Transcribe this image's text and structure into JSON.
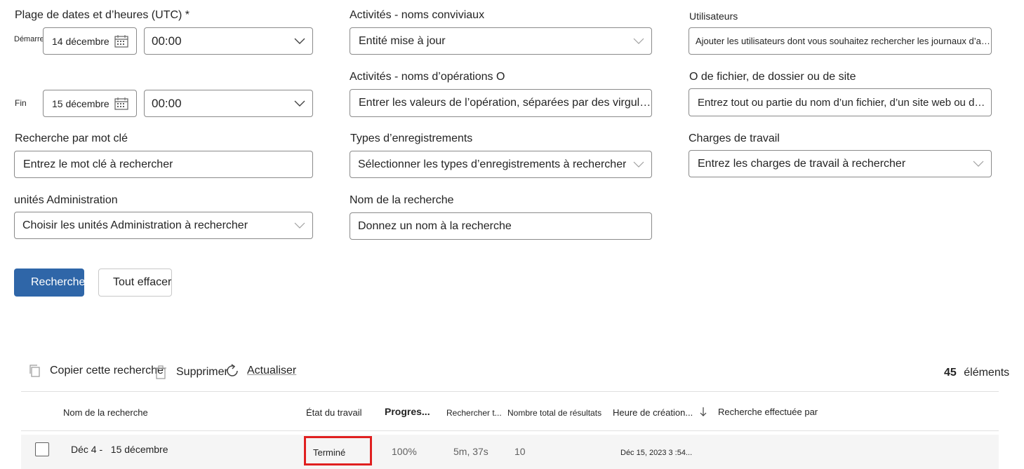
{
  "filters": {
    "date_range": {
      "label": "Plage de dates et d’heures (UTC) *",
      "start_label": "Démarrer",
      "start_date": "14 décembre",
      "start_time": "00:00",
      "end_label": "Fin",
      "end_date": "15 décembre",
      "end_time": "00:00"
    },
    "activities_friendly": {
      "label": "Activités - noms conviviaux",
      "value": "Entité mise à jour"
    },
    "activities_operations": {
      "label": "Activités - noms d’opérations O",
      "placeholder": "Entrer les valeurs de l’opération, séparées par des virgules"
    },
    "users": {
      "label": "Utilisateurs",
      "placeholder": "Ajouter les utilisateurs dont vous souhaitez rechercher les journaux d’audit"
    },
    "file_folder_site": {
      "label": "O de fichier, de dossier ou de site",
      "placeholder": "Entrez tout ou partie du nom d’un fichier, d’un site web ou d’un f…"
    },
    "keyword": {
      "label": "Recherche par mot clé",
      "placeholder": "Entrez le mot clé à rechercher"
    },
    "record_types": {
      "label": "Types d’enregistrements",
      "placeholder": "Sélectionner les types d’enregistrements à rechercher"
    },
    "workloads": {
      "label": "Charges de travail",
      "placeholder": "Entrez les charges de travail à rechercher"
    },
    "admin_units": {
      "label": "unités Administration",
      "placeholder": "Choisir les unités Administration à rechercher"
    },
    "search_name": {
      "label": "Nom de la recherche",
      "placeholder": "Donnez un nom à la recherche"
    }
  },
  "actions": {
    "search_label": "Recherche",
    "clear_label": "Tout effacer"
  },
  "toolbar": {
    "copy_label": "Copier cette recherche",
    "delete_label": "Supprimer",
    "refresh_label": "Actualiser",
    "count_number": "45",
    "count_label": "éléments"
  },
  "table": {
    "columns": {
      "name": "Nom de la recherche",
      "status": "État du travail",
      "progress": "Progres...",
      "search_time": "Rechercher t...",
      "total_results": "Nombre total de résultats",
      "created": "Heure de création...",
      "performed_by": "Recherche effectuée par"
    },
    "rows": [
      {
        "name": "Déc 4 -   15 décembre",
        "status": "Terminé",
        "progress": "100%",
        "search_time": "5m, 37s",
        "total_results": "10",
        "created": "Déc 15, 2023 3 :54..."
      }
    ]
  },
  "colors": {
    "primary": "#2f66a8",
    "highlight": "#e02020",
    "border": "#8a8a8a"
  }
}
